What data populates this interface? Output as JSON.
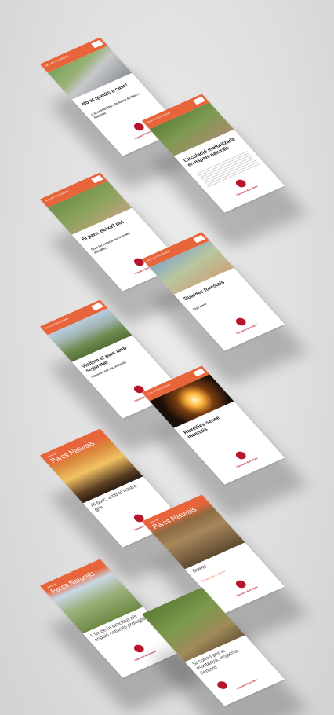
{
  "brochures": [
    {
      "band": "Xarxa de Parcs Naturals",
      "title": "No et quedis a casa!",
      "subtitle": "L'accessibilitat a la Xarxa de Parcs Naturals",
      "seal": "Diputació Barcelona"
    },
    {
      "band": "Xarxa de Parcs Naturals",
      "title": "Circulació motoritzada en espais naturals",
      "subtitle": "",
      "seal": "Diputació Barcelona"
    },
    {
      "band": "Xarxa de Parcs Naturals",
      "title": "El parc, deixa'l net",
      "subtitle": "Com fer natural, no hi volem deixalles",
      "seal": "Diputació Barcelona"
    },
    {
      "band": "Xarxa de Parcs Naturals",
      "title": "Guardes forestals",
      "subtitle": "Què fem?",
      "seal": "Diputació Barcelona"
    },
    {
      "band": "Xarxa de Parcs Naturals",
      "title": "Visitem el parc amb seguretat",
      "subtitle": "Consells per als visitants",
      "seal": "Diputació Barcelona"
    },
    {
      "band": "Xarxa de Parcs Naturals",
      "title": "Revetlles sense incendis",
      "subtitle": "",
      "seal": "Diputació Barcelona"
    },
    {
      "band": "Xarxa de",
      "parcs": "Parcs Naturals",
      "title": "Al parc, amb el nostre gos",
      "subtitle": "",
      "seal": "Diputació Barcelona"
    },
    {
      "band": "Xarxa de",
      "parcs": "Parcs Naturals",
      "title": "Bolets",
      "subtitle": "Consells per a collir-ne",
      "seal": "Diputació Barcelona"
    },
    {
      "band": "Xarxa de",
      "parcs": "Parcs Naturals",
      "title": "L'ús de la bicicleta als espais naturals protegits",
      "subtitle": "",
      "seal": "Diputació Barcelona"
    },
    {
      "band": "",
      "title": "Si corres per la muntanya, respecta l'entorn",
      "subtitle": "",
      "seal": "Diputació Barcelona"
    }
  ]
}
